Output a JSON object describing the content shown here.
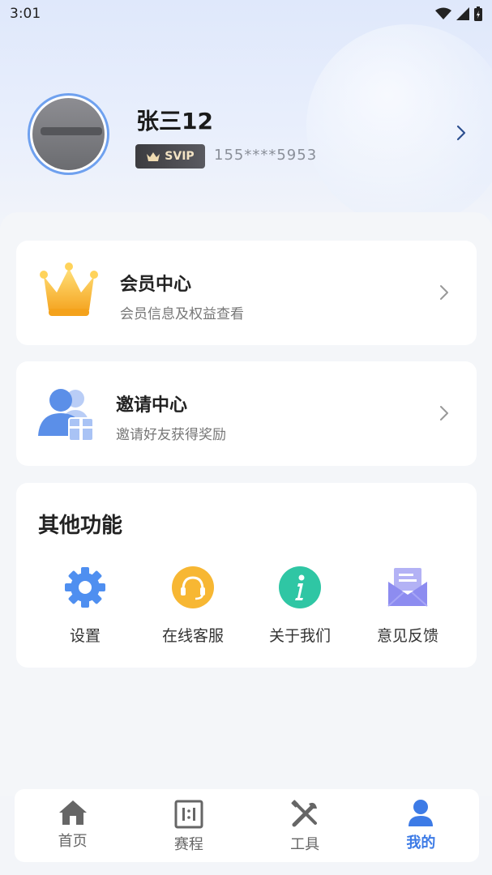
{
  "status_bar": {
    "time": "3:01"
  },
  "profile": {
    "name": "张三12",
    "badge": "SVIP",
    "phone": "155****5953"
  },
  "cards": [
    {
      "title": "会员中心",
      "subtitle": "会员信息及权益查看"
    },
    {
      "title": "邀请中心",
      "subtitle": "邀请好友获得奖励"
    }
  ],
  "other": {
    "title": "其他功能",
    "items": [
      {
        "label": "设置",
        "icon": "gear-icon"
      },
      {
        "label": "在线客服",
        "icon": "headset-icon"
      },
      {
        "label": "关于我们",
        "icon": "info-icon"
      },
      {
        "label": "意见反馈",
        "icon": "mail-icon"
      }
    ]
  },
  "tabbar": {
    "items": [
      {
        "label": "首页",
        "icon": "home-icon"
      },
      {
        "label": "赛程",
        "icon": "schedule-icon"
      },
      {
        "label": "工具",
        "icon": "tools-icon"
      },
      {
        "label": "我的",
        "icon": "user-icon"
      }
    ],
    "active_index": 3
  },
  "colors": {
    "accent": "#3d7be6",
    "gear": "#4f8ff0",
    "headset": "#f7b733",
    "info": "#2fc6a4",
    "mail": "#8d8cf0"
  }
}
